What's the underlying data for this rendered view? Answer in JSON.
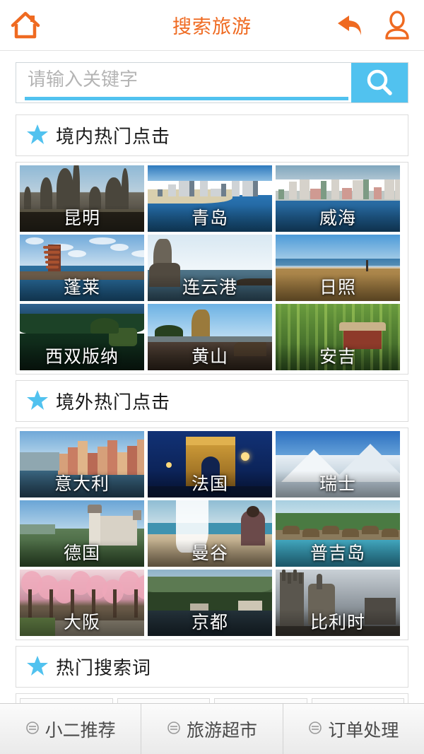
{
  "header": {
    "title": "搜索旅游",
    "home_icon": "home-icon",
    "back_icon": "back-arrow-icon",
    "user_icon": "user-icon",
    "accent_color": "#ef6a21"
  },
  "search": {
    "placeholder": "请输入关键字",
    "value": "",
    "button_icon": "search-icon",
    "button_color": "#51c2ef"
  },
  "sections": [
    {
      "id": "domestic",
      "star_icon": "star-icon",
      "star_color": "#51c2ef",
      "title": "境内热门点击",
      "rows": [
        [
          {
            "label": "昆明",
            "scene": "kunming"
          },
          {
            "label": "青岛",
            "scene": "qingdao"
          },
          {
            "label": "威海",
            "scene": "weihai"
          }
        ],
        [
          {
            "label": "蓬莱",
            "scene": "penglai"
          },
          {
            "label": "连云港",
            "scene": "lianyungang"
          },
          {
            "label": "日照",
            "scene": "rizhao"
          }
        ],
        [
          {
            "label": "西双版纳",
            "scene": "xishuangbanna"
          },
          {
            "label": "黄山",
            "scene": "huangshan"
          },
          {
            "label": "安吉",
            "scene": "anji"
          }
        ]
      ]
    },
    {
      "id": "overseas",
      "star_icon": "star-icon",
      "star_color": "#51c2ef",
      "title": "境外热门点击",
      "rows": [
        [
          {
            "label": "意大利",
            "scene": "italy"
          },
          {
            "label": "法国",
            "scene": "france"
          },
          {
            "label": "瑞士",
            "scene": "swiss"
          }
        ],
        [
          {
            "label": "德国",
            "scene": "germany"
          },
          {
            "label": "曼谷",
            "scene": "bangkok"
          },
          {
            "label": "普吉岛",
            "scene": "phuket"
          }
        ],
        [
          {
            "label": "大阪",
            "scene": "osaka"
          },
          {
            "label": "京都",
            "scene": "kyoto"
          },
          {
            "label": "比利时",
            "scene": "belgium"
          }
        ]
      ]
    }
  ],
  "hot_words": {
    "star_icon": "star-icon",
    "title": "热门搜索词",
    "tags": [
      "",
      "",
      "",
      ""
    ]
  },
  "bottom_nav": [
    {
      "icon": "list-bullet-icon",
      "label": "小二推荐"
    },
    {
      "icon": "list-bullet-icon",
      "label": "旅游超市"
    },
    {
      "icon": "list-bullet-icon",
      "label": "订单处理"
    }
  ]
}
